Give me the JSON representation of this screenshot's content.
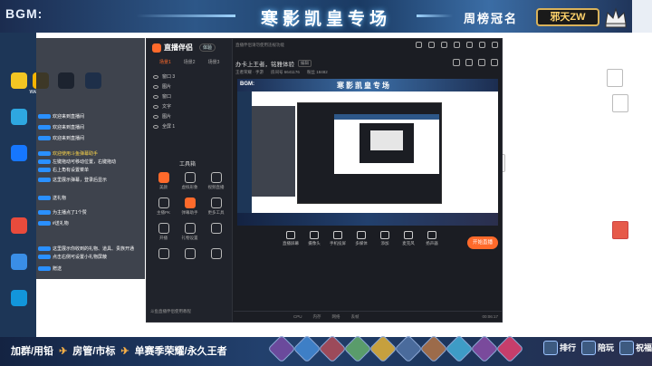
{
  "frame": {
    "bgm_label": "BGM:",
    "title": "寒影凯皇专场",
    "weekly_label": "周榜冠名",
    "champion_name": "邪天ZW",
    "ticker": [
      "加群/用铅",
      "房管/市标",
      "单赛季荣耀/永久王者"
    ],
    "rank_items": [
      "排行",
      "陪玩",
      "祝福"
    ]
  },
  "desktop": {
    "icons": [
      {
        "label": "",
        "color": "#f3c623"
      },
      {
        "label": "WeGame",
        "color": "#f5b400"
      },
      {
        "label": "Steam",
        "color": "#1b2838"
      },
      {
        "label": "",
        "color": "#2a7ae2"
      },
      {
        "label": "",
        "color": "#2ea7e0"
      },
      {
        "label": "",
        "color": "#1677ff"
      },
      {
        "label": "",
        "color": "#e94b3c"
      },
      {
        "label": "",
        "color": "#3a8ee6"
      },
      {
        "label": "",
        "color": "#1296db"
      }
    ],
    "right_files": [
      {
        "label": "",
        "red": false
      },
      {
        "label": "",
        "red": false
      },
      {
        "label": "",
        "red": false
      },
      {
        "label": "",
        "red": true
      }
    ]
  },
  "chat": {
    "lines": [
      {
        "text": "欢迎来到直播间",
        "yellow": false
      },
      {
        "text": "欢迎来到直播间",
        "yellow": false
      },
      {
        "text": "欢迎来到直播间",
        "yellow": false
      },
      {
        "text": "欢迎使用斗鱼弹幕助手",
        "yellow": true
      },
      {
        "text": "左键拖动可移动位置，右键拖动",
        "yellow": false
      },
      {
        "text": "右上角有设置菜单",
        "yellow": false
      },
      {
        "text": "这里展示弹幕，登录后显示",
        "yellow": false
      },
      {
        "text": "送礼物",
        "yellow": false
      },
      {
        "text": "为主播点了1个赞",
        "yellow": false
      },
      {
        "text": "#送礼物",
        "yellow": false
      },
      {
        "text": "这里展示你收到的礼物、道具、贵族开通",
        "yellow": false
      },
      {
        "text": "点击右侧可设置小礼物屏蔽",
        "yellow": false
      },
      {
        "text": "赠送",
        "yellow": false
      }
    ]
  },
  "app": {
    "logo": "直播伴侣",
    "logo_badge": "体验",
    "notice": "直播伴侣请勿使用违规功能",
    "scene_tabs": [
      "场景1",
      "场景2",
      "场景3"
    ],
    "sources": [
      "窗口 3",
      "图片",
      "窗口",
      "文字",
      "图片",
      "全屏 1"
    ],
    "tools_header": "工具箱",
    "tools": [
      "美颜",
      "虚拟形象",
      "视频直播",
      "主播PK",
      "弹幕助手",
      "更多工具",
      "开播",
      "礼物设置",
      "",
      "",
      "",
      ""
    ],
    "side_footer": "斗鱼直播伴侣使用教程",
    "room_title": "办卡上王者，铭雅体验",
    "room_tag": "编辑",
    "room_meta": [
      "王者荣耀 · 手游",
      "房间号 6641176",
      "粉丝 18482"
    ],
    "preview": {
      "bgm": "BGM:",
      "title": "寒影凯皇专场"
    },
    "controls": [
      "直播屏幕",
      "摄像头",
      "手机投屏",
      "多媒体",
      "添加",
      "麦克风",
      "扬声器"
    ],
    "start_button": "开始直播",
    "status": [
      "CPU",
      "内存",
      "网络",
      "丢帧"
    ],
    "timer": "00:06:17"
  },
  "colors": {
    "accent": "#ff6a2b",
    "banner": "#2d5788",
    "champion": "#ffd36b"
  }
}
